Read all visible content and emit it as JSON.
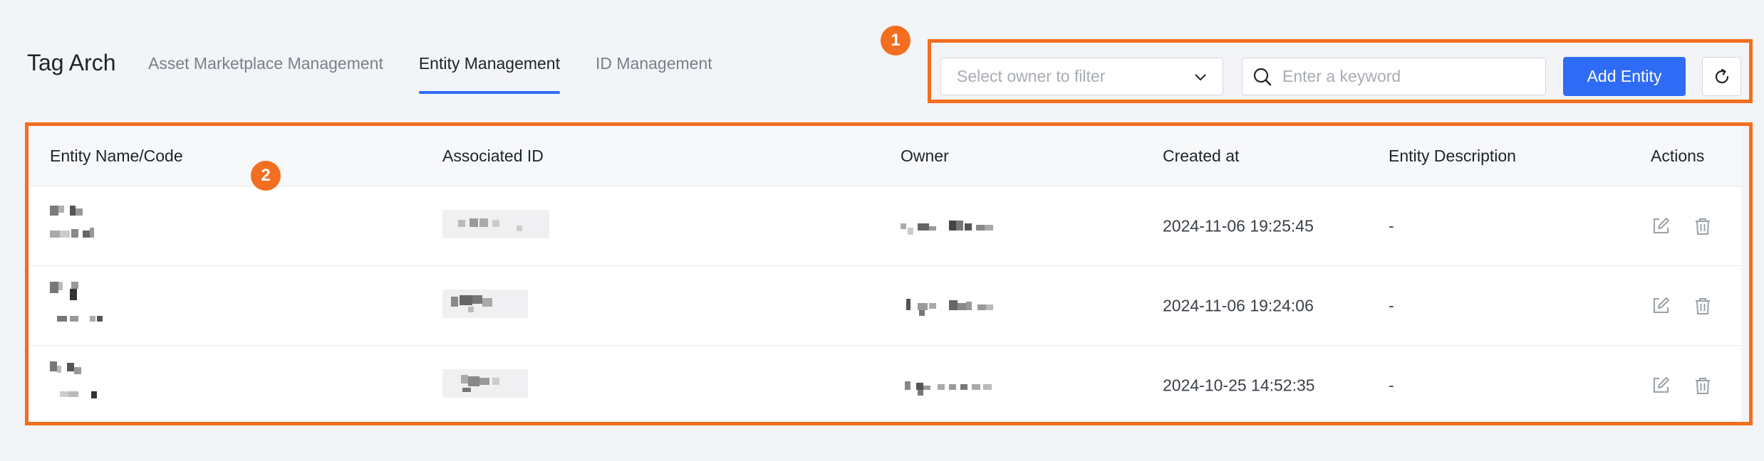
{
  "header": {
    "app_title": "Tag Arch",
    "tabs": [
      {
        "label": "Asset Marketplace Management",
        "active": false
      },
      {
        "label": "Entity Management",
        "active": true
      },
      {
        "label": "ID Management",
        "active": false
      }
    ]
  },
  "toolbar": {
    "owner_filter_placeholder": "Select owner to filter",
    "search_placeholder": "Enter a keyword",
    "add_label": "Add Entity",
    "refresh_icon": "refresh-icon"
  },
  "annotations": [
    "1",
    "2"
  ],
  "table": {
    "columns": [
      "Entity Name/Code",
      "Associated ID",
      "Owner",
      "Created at",
      "Entity Description",
      "Actions"
    ],
    "rows": [
      {
        "created_at": "2024-11-06 19:25:45",
        "description": "-"
      },
      {
        "created_at": "2024-11-06 19:24:06",
        "description": "-"
      },
      {
        "created_at": "2024-10-25 14:52:35",
        "description": "-"
      }
    ],
    "action_icons": [
      "edit-icon",
      "delete-icon"
    ]
  },
  "colors": {
    "accent": "#2f6cf6",
    "annotation": "#f36e1e",
    "background": "#f3f4f8"
  }
}
